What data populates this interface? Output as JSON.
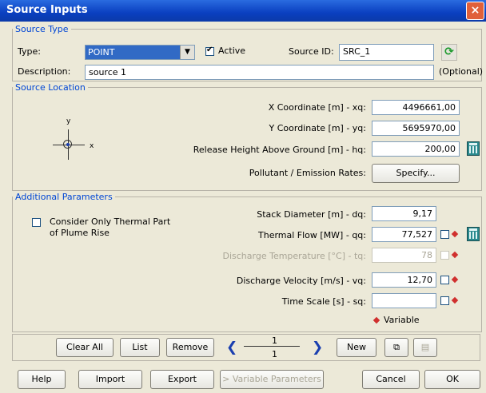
{
  "window": {
    "title": "Source Inputs",
    "close": "×"
  },
  "source_type": {
    "legend": "Source Type",
    "type_label": "Type:",
    "type_value": "POINT",
    "active_label": "Active",
    "active_checked": true,
    "source_id_label": "Source ID:",
    "source_id_value": "SRC_1",
    "description_label": "Description:",
    "description_value": "source 1",
    "optional_label": "(Optional)"
  },
  "source_location": {
    "legend": "Source Location",
    "x_label": "X Coordinate [m] - xq:",
    "x_value": "4496661,00",
    "y_label": "Y Coordinate [m] - yq:",
    "y_value": "5695970,00",
    "h_label": "Release Height Above Ground [m] - hq:",
    "h_value": "200,00",
    "pollutant_label": "Pollutant / Emission Rates:",
    "specify_button": "Specify...",
    "axis_y": "y",
    "axis_x": "x"
  },
  "additional": {
    "legend": "Additional Parameters",
    "thermal_only_label_1": "Consider Only Thermal Part",
    "thermal_only_label_2": "of Plume Rise",
    "stack_label": "Stack Diameter [m] - dq:",
    "stack_value": "9,17",
    "thermal_label": "Thermal Flow [MW] - qq:",
    "thermal_value": "77,527",
    "temp_label": "Discharge Temperature [°C] - tq:",
    "temp_value": "78",
    "velocity_label": "Discharge Velocity [m/s] - vq:",
    "velocity_value": "12,70",
    "timescale_label": "Time Scale [s] - sq:",
    "timescale_value": "",
    "variable_legend": "Variable"
  },
  "nav": {
    "clear_all": "Clear All",
    "list": "List",
    "remove": "Remove",
    "record_current": "1",
    "record_total": "1",
    "new": "New"
  },
  "footer": {
    "help": "Help",
    "import": "Import",
    "export": "Export",
    "variable_parameters": "> Variable Parameters",
    "cancel": "Cancel",
    "ok": "OK"
  },
  "colors": {
    "legend": "#0046d5",
    "accent": "#d0302e",
    "title": "#0a3fc0"
  }
}
